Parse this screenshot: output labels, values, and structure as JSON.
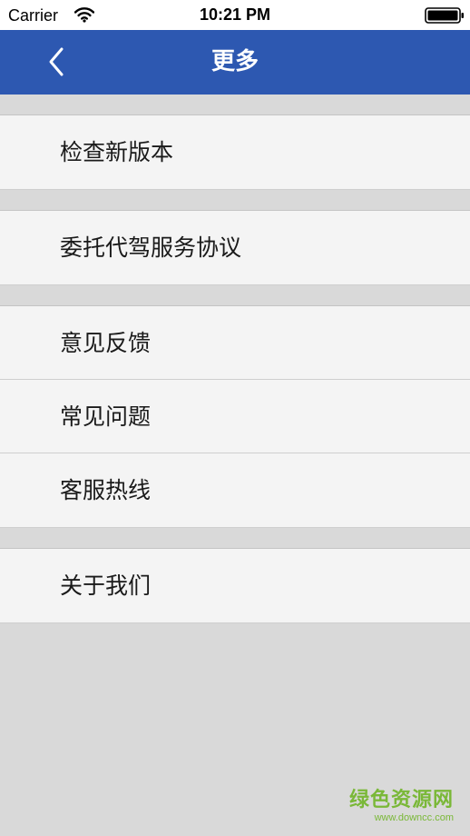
{
  "status_bar": {
    "carrier": "Carrier",
    "time": "10:21 PM"
  },
  "nav": {
    "title": "更多",
    "back_icon": "chevron-left-icon"
  },
  "menu": {
    "items": [
      "检查新版本",
      "委托代驾服务协议",
      "意见反馈",
      "常见问题",
      "客服热线",
      "关于我们"
    ]
  },
  "watermark": {
    "title": "绿色资源网",
    "url": "www.downcc.com"
  },
  "colors": {
    "nav_background": "#2d58b1",
    "page_background": "#d9d9d9",
    "row_background": "#f4f4f4",
    "watermark": "#7ab838"
  }
}
